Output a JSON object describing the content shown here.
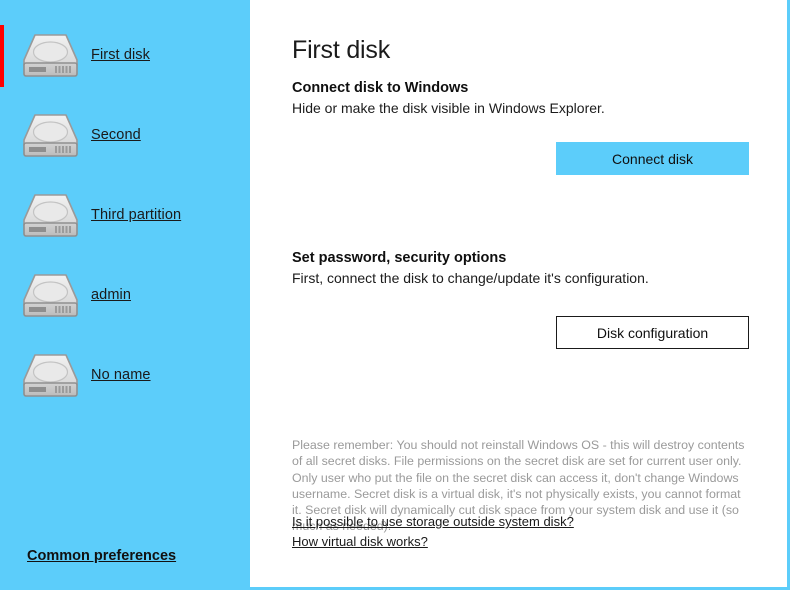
{
  "window": {
    "controls": {
      "more_label": "•••",
      "more_name": "more-options",
      "minimize_label": "",
      "close_label": "✕"
    }
  },
  "sidebar": {
    "background_color": "#5ccdfa",
    "selection_color": "#ff0000",
    "items": [
      {
        "label": "First disk",
        "icon": "hard-disk-icon",
        "selected": true
      },
      {
        "label": "Second",
        "icon": "hard-disk-icon",
        "selected": false
      },
      {
        "label": "Third partition",
        "icon": "hard-disk-icon",
        "selected": false
      },
      {
        "label": "admin",
        "icon": "hard-disk-icon",
        "selected": false
      },
      {
        "label": "No name",
        "icon": "hard-disk-icon",
        "selected": false
      }
    ],
    "common_preferences_label": "Common preferences"
  },
  "main": {
    "title": "First disk",
    "sections": [
      {
        "heading": "Connect disk to Windows",
        "subtitle": "Hide or make the disk visible in Windows Explorer.",
        "button_label": "Connect disk",
        "button_color": "#5ccdfa"
      },
      {
        "heading": "Set password, security options",
        "subtitle": "First, connect the disk to change/update it's configuration.",
        "button_label": "Disk configuration",
        "button_color": "#ffffff"
      }
    ],
    "fineprint": "Please remember: You should not reinstall Windows OS - this will destroy contents of all secret disks. File permissions on the secret disk are set for current user only. Only user who put the file on the secret disk can access it, don't change Windows username. Secret disk is a virtual disk, it's not physically exists, you cannot format it. Secret disk will dynamically cut disk space from your system disk and use it (so much as needed).",
    "links": [
      "Is it possible to use storage outside system disk?",
      "How virtual disk works?"
    ]
  }
}
